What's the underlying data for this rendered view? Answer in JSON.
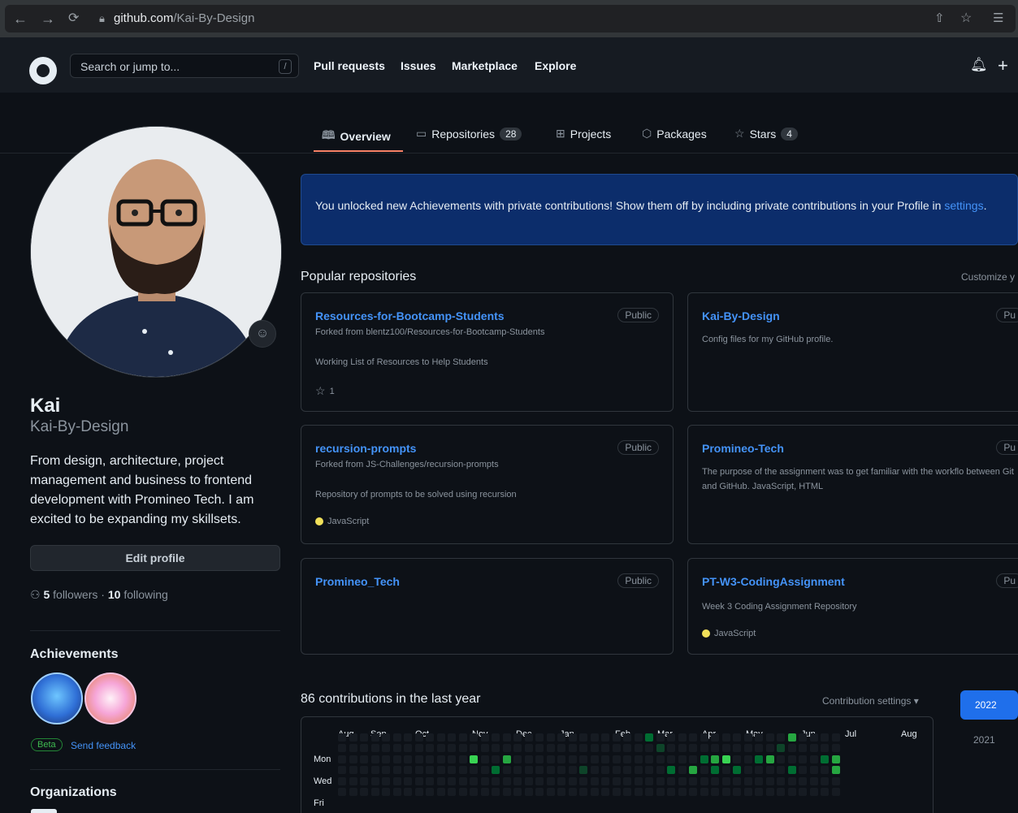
{
  "browser": {
    "url_host": "github.com",
    "url_path": "/Kai-By-Design"
  },
  "header": {
    "search_placeholder": "Search or jump to...",
    "search_shortcut": "/",
    "nav": [
      "Pull requests",
      "Issues",
      "Marketplace",
      "Explore"
    ],
    "plus": "+"
  },
  "tabs": [
    {
      "label": "Overview",
      "icon": "book-icon"
    },
    {
      "label": "Repositories",
      "count": "28",
      "icon": "repo-icon"
    },
    {
      "label": "Projects",
      "icon": "table-icon"
    },
    {
      "label": "Packages",
      "icon": "package-icon"
    },
    {
      "label": "Stars",
      "count": "4",
      "icon": "star-icon"
    }
  ],
  "profile": {
    "name": "Kai",
    "login": "Kai-By-Design",
    "bio": "From design, architecture, project management and business to frontend development with Promineo Tech. I am excited to be expanding my skillsets.",
    "edit_label": "Edit profile",
    "followers": "5",
    "followers_label": "followers",
    "separator": "·",
    "following": "10",
    "following_label": "following",
    "achievements_title": "Achievements",
    "beta_label": "Beta",
    "feedback_label": "Send feedback",
    "organizations_title": "Organizations"
  },
  "banner": {
    "text": "You unlocked new Achievements with private contributions! Show them off by including private contributions in your Profile in",
    "link": "settings",
    "end": "."
  },
  "popular": {
    "title": "Popular repositories",
    "customize": "Customize y",
    "repos": [
      {
        "name": "Resources-for-Bootcamp-Students",
        "visibility": "Public",
        "fork": "Forked from blentz100/Resources-for-Bootcamp-Students",
        "desc": "Working List of Resources to Help Students",
        "stars": "1"
      },
      {
        "name": "Kai-By-Design",
        "visibility": "Pu",
        "desc": "Config files for my GitHub profile."
      },
      {
        "name": "recursion-prompts",
        "visibility": "Public",
        "fork": "Forked from JS-Challenges/recursion-prompts",
        "desc": "Repository of prompts to be solved using recursion",
        "language": "JavaScript"
      },
      {
        "name": "Promineo-Tech",
        "visibility": "Pu",
        "desc": "The purpose of the assignment was to get familiar with the workflo between Git and GitHub. JavaScript, HTML"
      },
      {
        "name": "Promineo_Tech",
        "visibility": "Public"
      },
      {
        "name": "PT-W3-CodingAssignment",
        "visibility": "Pu",
        "desc": "Week 3 Coding Assignment Repository",
        "language": "JavaScript"
      }
    ]
  },
  "contributions": {
    "title": "86 contributions in the last year",
    "settings": "Contribution settings ▾",
    "months": [
      "Aug",
      "Sep",
      "Oct",
      "Nov",
      "Dec",
      "Jan",
      "Feb",
      "Mar",
      "Apr",
      "May",
      "Jun",
      "Jul",
      "Aug"
    ],
    "days": [
      "Mon",
      "Wed",
      "Fri"
    ],
    "years": [
      "2022",
      "2021"
    ]
  },
  "colors": {
    "accent_link": "#4493f8",
    "tab_underline": "#f78166",
    "language_js": "#f1e05a",
    "contrib_l0": "#161b22",
    "contrib_l1": "#0e4429",
    "contrib_l2": "#006d32",
    "contrib_l3": "#26a641",
    "contrib_l4": "#39d353"
  }
}
